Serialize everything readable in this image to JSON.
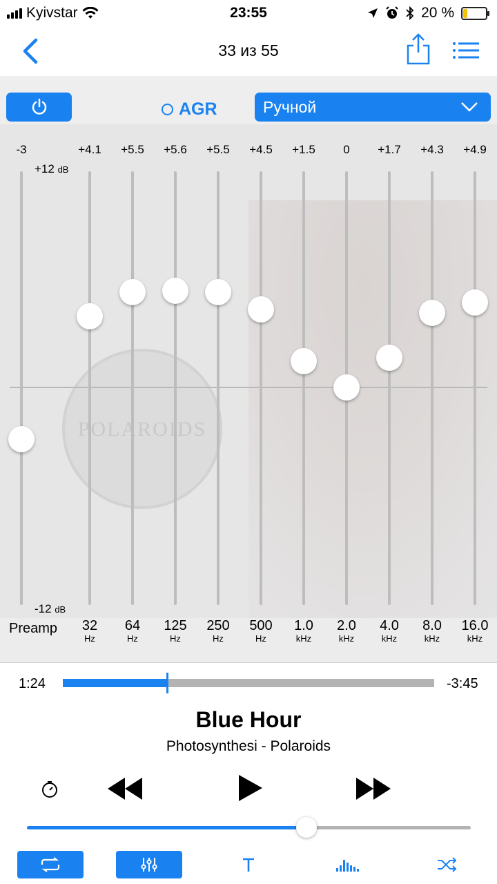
{
  "status": {
    "carrier": "Kyivstar",
    "time": "23:55",
    "battery": "20 %",
    "battery_level": 0.2
  },
  "nav": {
    "track_counter": "33 из 55",
    "back_icon": "chevron-left-icon",
    "share_icon": "share-icon",
    "playlist_icon": "list-icon"
  },
  "toolbar": {
    "power_icon": "power-icon",
    "agr_label": "AGR",
    "preset": "Ручной"
  },
  "eq": {
    "top_db": "+12",
    "bottom_db": "-12",
    "db_unit": "dB",
    "preamp_label": "Preamp",
    "preamp_gain_text": "-3",
    "preamp_gain": -3,
    "watermark": "POLAROIDS",
    "bands": [
      {
        "gain_text": "+4.1",
        "gain": 4.1,
        "freq": "32",
        "unit": "Hz"
      },
      {
        "gain_text": "+5.5",
        "gain": 5.5,
        "freq": "64",
        "unit": "Hz"
      },
      {
        "gain_text": "+5.6",
        "gain": 5.6,
        "freq": "125",
        "unit": "Hz"
      },
      {
        "gain_text": "+5.5",
        "gain": 5.5,
        "freq": "250",
        "unit": "Hz"
      },
      {
        "gain_text": "+4.5",
        "gain": 4.5,
        "freq": "500",
        "unit": "Hz"
      },
      {
        "gain_text": "+1.5",
        "gain": 1.5,
        "freq": "1.0",
        "unit": "kHz"
      },
      {
        "gain_text": "0",
        "gain": 0,
        "freq": "2.0",
        "unit": "kHz"
      },
      {
        "gain_text": "+1.7",
        "gain": 1.7,
        "freq": "4.0",
        "unit": "kHz"
      },
      {
        "gain_text": "+4.3",
        "gain": 4.3,
        "freq": "8.0",
        "unit": "kHz"
      },
      {
        "gain_text": "+4.9",
        "gain": 4.9,
        "freq": "16.0",
        "unit": "kHz"
      }
    ]
  },
  "player": {
    "elapsed": "1:24",
    "remaining": "-3:45",
    "progress": 0.28,
    "title": "Blue Hour",
    "subtitle": "Photosynthesi - Polaroids",
    "volume": 0.63
  },
  "colors": {
    "accent": "#1a82f0"
  }
}
